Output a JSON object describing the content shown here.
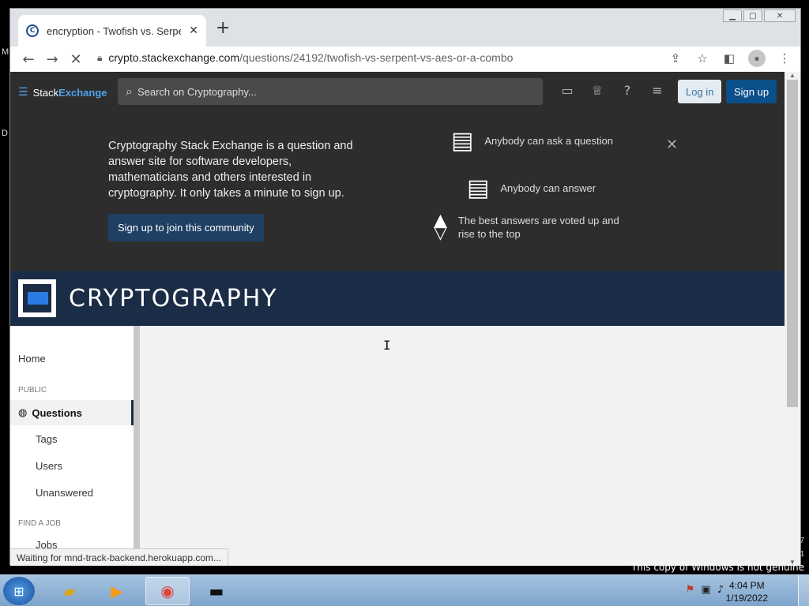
{
  "desktop": {
    "left_frag_1": "M",
    "left_frag_2": "D",
    "right_frag_1": "7",
    "right_frag_2": "1",
    "watermark": "This copy of Windows is not genuine"
  },
  "browser": {
    "tab_title": "encryption - Twofish vs. Serpent",
    "tab_close": "✕",
    "new_tab": "+",
    "url_host": "crypto.stackexchange.com",
    "url_path": "/questions/24192/twofish-vs-serpent-vs-aes-or-a-combo",
    "status_text": "Waiting for mnd-track-backend.herokuapp.com..."
  },
  "se_topbar": {
    "logo_stack": "Stack",
    "logo_exchange": "Exchange",
    "search_placeholder": "Search on Cryptography...",
    "login_label": "Log in",
    "signup_label": "Sign up"
  },
  "hero": {
    "description": "Cryptography Stack Exchange is a question and answer site for software developers, mathematicians and others interested in cryptography. It only takes a minute to sign up.",
    "cta_label": "Sign up to join this community",
    "feature_1": "Anybody can ask a question",
    "feature_2": "Anybody can answer",
    "feature_3_line1": "The best answers are voted up and",
    "feature_3_line2": "rise to the top"
  },
  "banner": {
    "site_title": "CRYPTOGRAPHY"
  },
  "leftnav": {
    "home": "Home",
    "public_header": "PUBLIC",
    "questions": "Questions",
    "tags": "Tags",
    "users": "Users",
    "unanswered": "Unanswered",
    "job_header": "FIND A JOB",
    "jobs": "Jobs"
  },
  "taskbar": {
    "time": "4:04 PM",
    "date": "1/19/2022"
  },
  "colors": {
    "se_dark": "#2d2d2d",
    "banner_navy": "#1b2d46",
    "accent_blue": "#4fa3ea",
    "signup_blue": "#0a4f8a"
  }
}
